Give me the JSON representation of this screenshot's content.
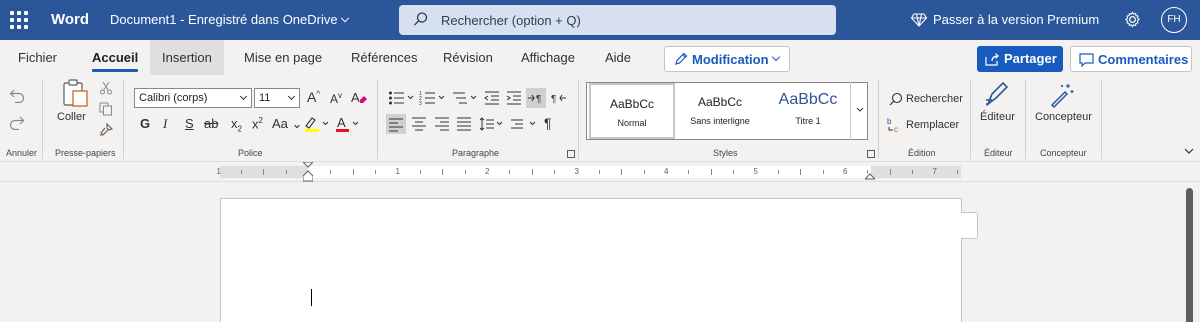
{
  "titlebar": {
    "app_name": "Word",
    "doc_title": "Document1 - Enregistré dans OneDrive",
    "search_placeholder": "Rechercher (option + Q)",
    "premium_label": "Passer à la version Premium",
    "avatar_initials": "FH"
  },
  "tabs": {
    "fichier": "Fichier",
    "accueil": "Accueil",
    "insertion": "Insertion",
    "mise_en_page": "Mise en page",
    "references": "Références",
    "revision": "Révision",
    "affichage": "Affichage",
    "aide": "Aide",
    "mode": "Modification",
    "share": "Partager",
    "comments": "Commentaires"
  },
  "ribbon": {
    "groups": {
      "annuler": "Annuler",
      "presse_papiers": "Presse-papiers",
      "police": "Police",
      "paragraphe": "Paragraphe",
      "styles": "Styles",
      "edition": "Édition",
      "editeur": "Éditeur",
      "concepteur": "Concepteur"
    },
    "coller": "Coller",
    "font_name": "Calibri (corps)",
    "font_size": "11",
    "grow_font": "A",
    "shrink_font": "A",
    "bold": "G",
    "italic": "I",
    "underline": "S",
    "strike": "ab",
    "subscript": "x",
    "superscript": "x",
    "case": "Aa",
    "styles": [
      {
        "preview": "AaBbCc",
        "name": "Normal"
      },
      {
        "preview": "AaBbCc",
        "name": "Sans interligne"
      },
      {
        "preview": "AaBbCc",
        "name": "Titre 1"
      }
    ],
    "rechercher": "Rechercher",
    "remplacer": "Remplacer",
    "editeur_btn": "Éditeur",
    "concepteur_btn": "Concepteur"
  },
  "ruler": {
    "numbers": [
      "1",
      "1",
      "2",
      "3",
      "4",
      "5",
      "6",
      "7"
    ]
  },
  "colors": {
    "brand": "#2b579a",
    "accent": "#185abd",
    "highlight": "#ffff00",
    "font_color": "#e81123"
  }
}
